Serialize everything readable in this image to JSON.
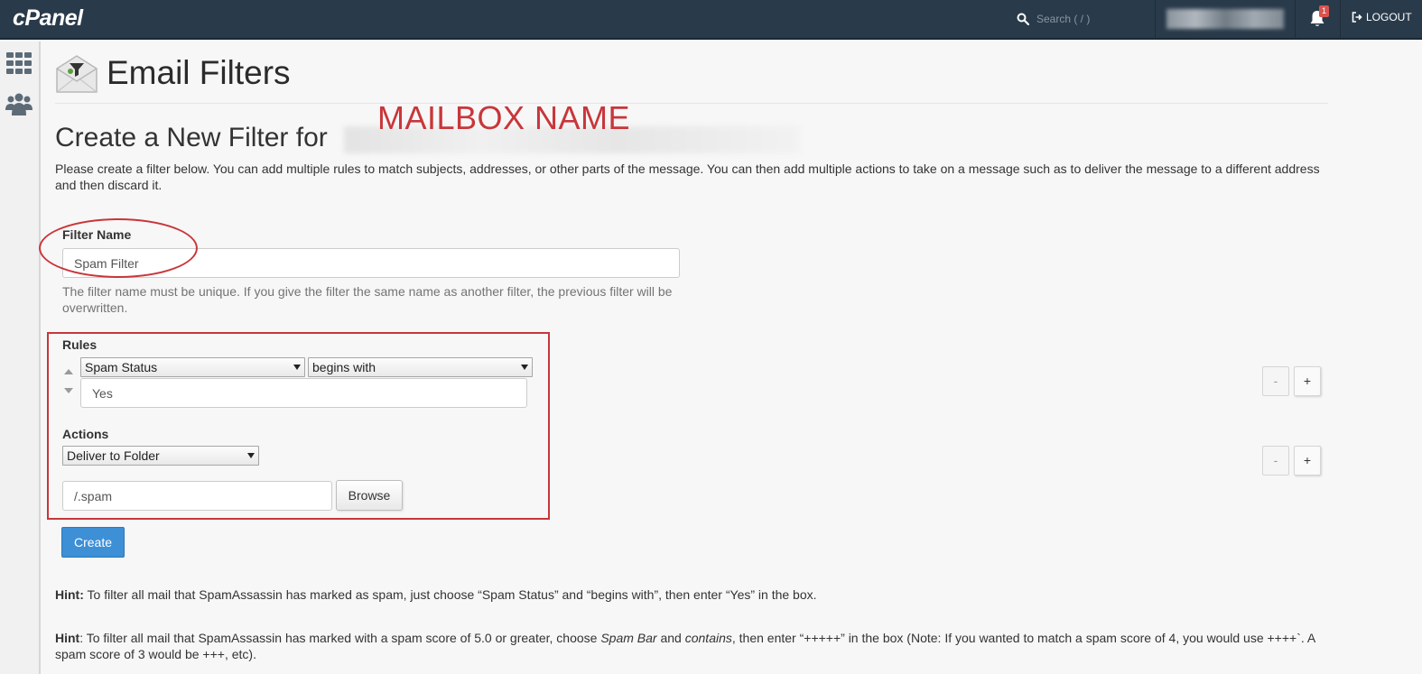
{
  "topbar": {
    "logo": "cPanel",
    "search_placeholder": "Search ( / )",
    "notification_count": "1",
    "logout_label": "LOGOUT"
  },
  "sidebar": {
    "items": [
      {
        "icon": "grid-icon"
      },
      {
        "icon": "users-icon"
      }
    ]
  },
  "page": {
    "title": "Email Filters",
    "annotation_label": "MAILBOX NAME",
    "subtitle": "Create a New Filter for",
    "intro": "Please create a filter below. You can add multiple rules to match subjects, addresses, or other parts of the message. You can then add multiple actions to take on a message such as to deliver the message to a different address and then discard it."
  },
  "form": {
    "filter_name_label": "Filter Name",
    "filter_name_value": "Spam Filter",
    "filter_name_help": "The filter name must be unique. If you give the filter the same name as another filter, the previous filter will be overwritten.",
    "rules_label": "Rules",
    "rule_field": "Spam Status",
    "rule_operator": "begins with",
    "rule_value": "Yes",
    "actions_label": "Actions",
    "action_type": "Deliver to Folder",
    "action_value": "/.spam",
    "browse_label": "Browse",
    "minus_label": "-",
    "plus_label": "+",
    "create_label": "Create"
  },
  "hints": {
    "hint1_prefix": "Hint:",
    "hint1_text": " To filter all mail that SpamAssassin has marked as spam, just choose “Spam Status” and “begins with”, then enter “Yes” in the box.",
    "hint2_prefix": "Hint",
    "hint2_part1": ": To filter all mail that SpamAssassin has marked with a spam score of 5.0 or greater, choose ",
    "hint2_em1": "Spam Bar",
    "hint2_part2": " and ",
    "hint2_em2": "contains",
    "hint2_part3": ", then enter “+++++” in the box (Note: If you wanted to match a spam score of 4, you would use ++++`. A spam score of 3 would be +++, etc)."
  },
  "colors": {
    "topbar_bg": "#293a4a",
    "annotation_red": "#c8363a",
    "primary_button": "#3d8fd6"
  }
}
